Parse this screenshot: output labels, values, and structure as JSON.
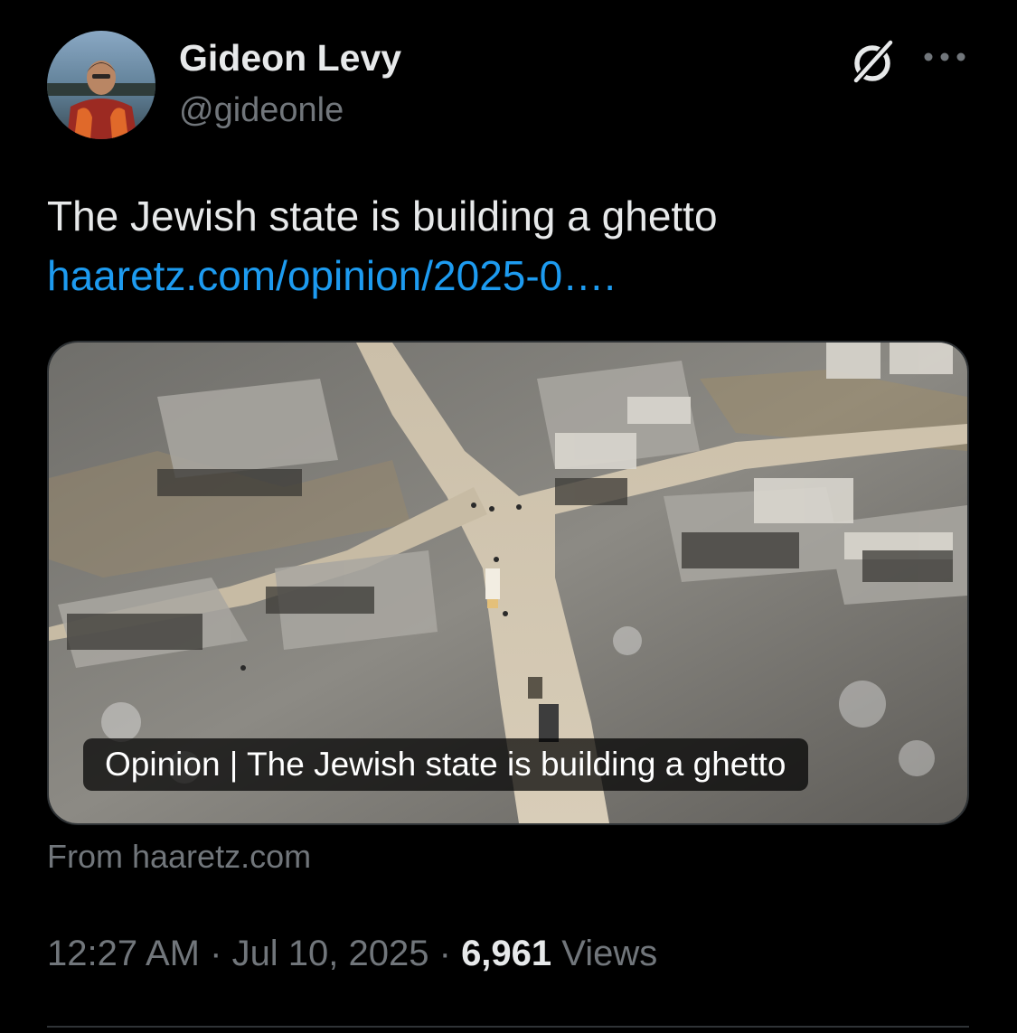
{
  "author": {
    "display_name": "Gideon Levy",
    "handle": "@gideonle"
  },
  "icons": {
    "grok": "grok-icon",
    "more": "more-options-icon"
  },
  "tweet": {
    "text": "The Jewish state is building a ghetto",
    "link": "haaretz.com/opinion/2025-0…."
  },
  "card": {
    "caption": "Opinion | The Jewish state is building a ghetto",
    "source": "From haaretz.com"
  },
  "meta": {
    "time": "12:27 AM",
    "separator": " · ",
    "date": "Jul 10, 2025",
    "views_count": "6,961",
    "views_label": "Views"
  },
  "colors": {
    "background": "#000000",
    "primary_text": "#e7e9ea",
    "secondary_text": "#71767b",
    "link": "#1d9bf0",
    "border": "#2f3336"
  }
}
